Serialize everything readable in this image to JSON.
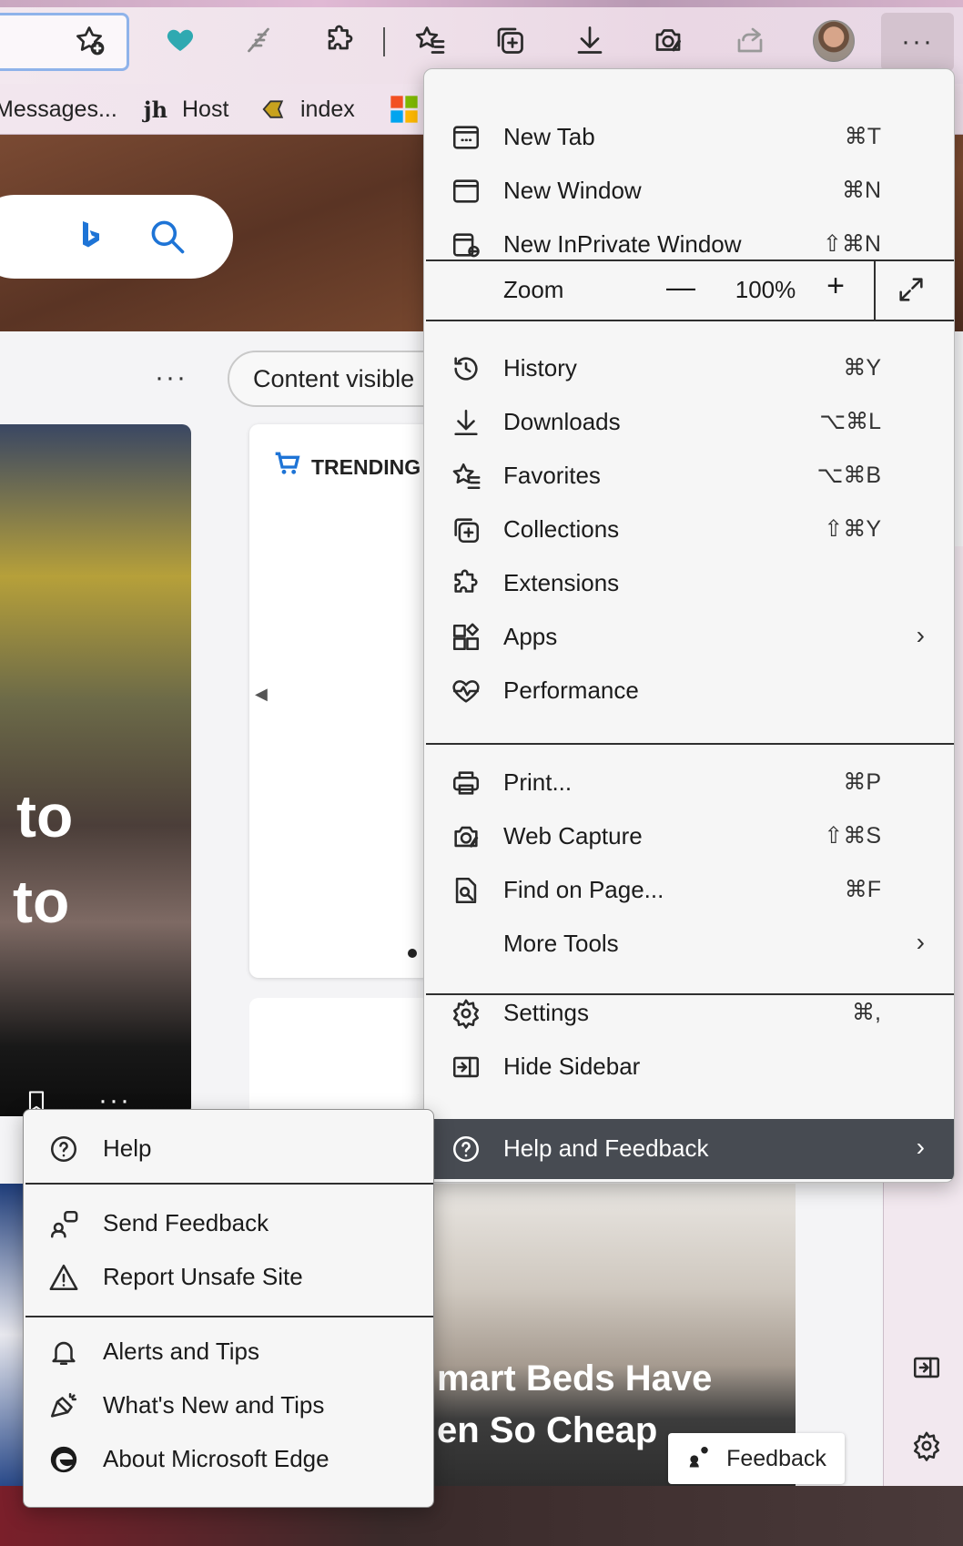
{
  "toolbar": {
    "icons": [
      "add-favorite-icon",
      "heart-icon",
      "feather-icon",
      "extensions-icon",
      "favorites-icon",
      "collections-icon",
      "downloads-icon",
      "web-capture-icon",
      "share-icon",
      "profile-avatar",
      "more-icon"
    ],
    "more_label": "···"
  },
  "favorites_bar": {
    "items": [
      {
        "label": "Messages...",
        "icon": "messages-icon"
      },
      {
        "label": "Host",
        "icon": "jh-icon"
      },
      {
        "label": "index",
        "icon": "index-icon"
      }
    ]
  },
  "page": {
    "dots": "···",
    "content_pill": "Content visible",
    "card_words": [
      "to",
      "to"
    ],
    "trending_label": "TRENDING",
    "bed_title_line1": "mart Beds Have",
    "bed_title_line2": "en So Cheap",
    "feedback_label": "Feedback",
    "mini_dots": "···"
  },
  "menu": {
    "items": [
      {
        "label": "New Tab",
        "shortcut": "⌘T",
        "icon": "new-tab-icon"
      },
      {
        "label": "New Window",
        "shortcut": "⌘N",
        "icon": "new-window-icon"
      },
      {
        "label": "New InPrivate Window",
        "shortcut": "⇧⌘N",
        "icon": "inprivate-icon"
      }
    ],
    "zoom": {
      "label": "Zoom",
      "minus": "—",
      "value": "100%",
      "plus": "+"
    },
    "items2": [
      {
        "label": "History",
        "shortcut": "⌘Y",
        "icon": "history-icon"
      },
      {
        "label": "Downloads",
        "shortcut": "⌥⌘L",
        "icon": "downloads-icon"
      },
      {
        "label": "Favorites",
        "shortcut": "⌥⌘B",
        "icon": "favorites-icon"
      },
      {
        "label": "Collections",
        "shortcut": "⇧⌘Y",
        "icon": "collections-icon"
      },
      {
        "label": "Extensions",
        "shortcut": "",
        "icon": "extensions-icon"
      },
      {
        "label": "Apps",
        "shortcut": "",
        "icon": "apps-icon",
        "submenu": true
      },
      {
        "label": "Performance",
        "shortcut": "",
        "icon": "performance-icon"
      }
    ],
    "items3": [
      {
        "label": "Print...",
        "shortcut": "⌘P",
        "icon": "print-icon"
      },
      {
        "label": "Web Capture",
        "shortcut": "⇧⌘S",
        "icon": "web-capture-icon"
      },
      {
        "label": "Find on Page...",
        "shortcut": "⌘F",
        "icon": "find-icon"
      },
      {
        "label": "More Tools",
        "shortcut": "",
        "icon": "",
        "submenu": true
      }
    ],
    "items4": [
      {
        "label": "Settings",
        "shortcut": "⌘,",
        "icon": "settings-icon"
      },
      {
        "label": "Hide Sidebar",
        "shortcut": "",
        "icon": "hide-sidebar-icon"
      },
      {
        "label": "Help and Feedback",
        "shortcut": "",
        "icon": "help-icon",
        "submenu": true,
        "active": true
      }
    ],
    "chevron": "›"
  },
  "help_submenu": {
    "items": [
      {
        "label": "Help",
        "icon": "help-icon"
      },
      {
        "label": "Send Feedback",
        "icon": "send-feedback-icon"
      },
      {
        "label": "Report Unsafe Site",
        "icon": "warning-icon"
      },
      {
        "label": "Alerts and Tips",
        "icon": "bell-icon"
      },
      {
        "label": "What's New and Tips",
        "icon": "megaphone-icon"
      },
      {
        "label": "About Microsoft Edge",
        "icon": "edge-logo-icon"
      }
    ]
  },
  "colors": {
    "menu_bg": "#f6f6f6",
    "active_row": "#474b52",
    "accent_blue": "#1e74d6",
    "heart": "#2fa9b1"
  }
}
